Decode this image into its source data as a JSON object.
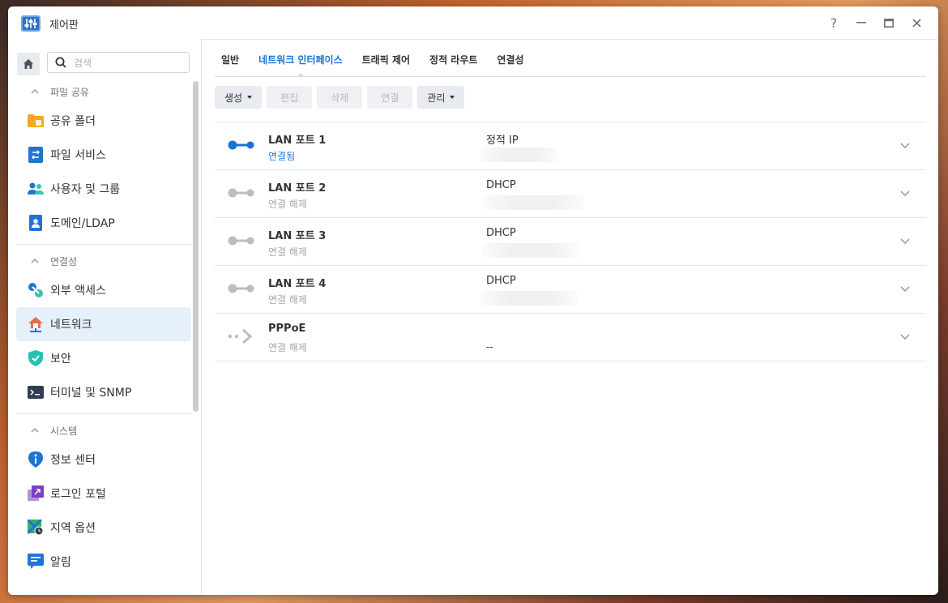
{
  "window": {
    "title": "제어판",
    "controls": [
      "?",
      "—",
      "□",
      "✕"
    ]
  },
  "sidebar": {
    "search_placeholder": "검색",
    "sections": [
      {
        "header": "파일 공유",
        "items": [
          {
            "label": "공유 폴더",
            "icon": "shared-folder-icon"
          },
          {
            "label": "파일 서비스",
            "icon": "file-services-icon"
          },
          {
            "label": "사용자 및 그룹",
            "icon": "users-groups-icon"
          },
          {
            "label": "도메인/LDAP",
            "icon": "domain-ldap-icon"
          }
        ]
      },
      {
        "header": "연결성",
        "items": [
          {
            "label": "외부 액세스",
            "icon": "external-access-icon"
          },
          {
            "label": "네트워크",
            "icon": "network-icon",
            "active": true
          },
          {
            "label": "보안",
            "icon": "security-shield-icon"
          },
          {
            "label": "터미널 및 SNMP",
            "icon": "terminal-icon"
          }
        ]
      },
      {
        "header": "시스템",
        "items": [
          {
            "label": "정보 센터",
            "icon": "info-center-icon"
          },
          {
            "label": "로그인 포털",
            "icon": "login-portal-icon"
          },
          {
            "label": "지역 옵션",
            "icon": "regional-options-icon"
          },
          {
            "label": "알림",
            "icon": "notification-icon"
          }
        ]
      }
    ]
  },
  "tabs": [
    {
      "label": "일반"
    },
    {
      "label": "네트워크 인터페이스",
      "active": true
    },
    {
      "label": "트래픽 제어"
    },
    {
      "label": "정적 라우트"
    },
    {
      "label": "연결성"
    }
  ],
  "toolbar": {
    "create": "생성",
    "edit": "편집",
    "delete": "삭제",
    "connect": "연결",
    "manage": "관리"
  },
  "interfaces": [
    {
      "name": "LAN 포트 1",
      "status": "연결됨",
      "connected": true,
      "mode": "정적 IP",
      "ip": ""
    },
    {
      "name": "LAN 포트 2",
      "status": "연결 해제",
      "connected": false,
      "mode": "DHCP",
      "ip": ""
    },
    {
      "name": "LAN 포트 3",
      "status": "연결 해제",
      "connected": false,
      "mode": "DHCP",
      "ip": ""
    },
    {
      "name": "LAN 포트 4",
      "status": "연결 해제",
      "connected": false,
      "mode": "DHCP",
      "ip": ""
    },
    {
      "name": "PPPoE",
      "status": "연결 해제",
      "connected": false,
      "mode": "",
      "ip": "--"
    }
  ],
  "colors": {
    "accent": "#1a73d6",
    "active_bg": "#e6f0fb",
    "disconnected_icon": "#b9bec4"
  }
}
